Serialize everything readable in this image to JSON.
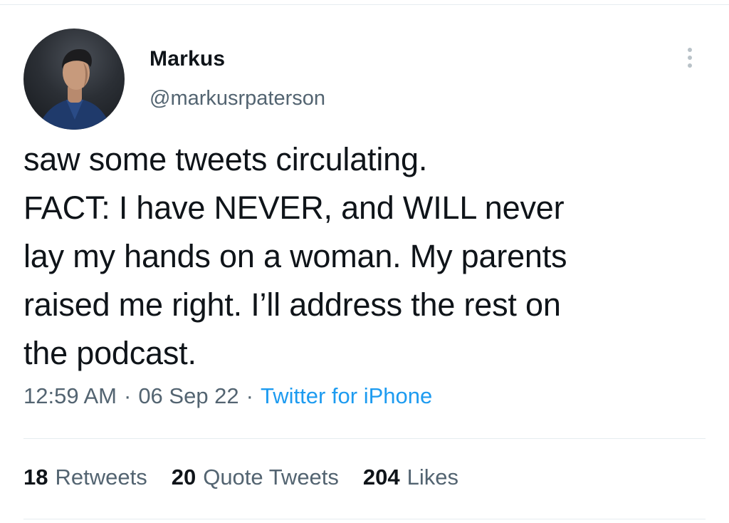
{
  "author": {
    "name": "Markus",
    "handle": "@markusrpaterson"
  },
  "tweet": {
    "text": "saw some tweets circulating.\nFACT: I have NEVER, and WILL never\nlay my hands on a woman. My parents\nraised me right. I’ll address the rest on\nthe podcast.",
    "time": "12:59 AM",
    "date": "06 Sep 22",
    "source": "Twitter for iPhone",
    "separator": "·"
  },
  "stats": {
    "retweets_count": "18",
    "retweets_label": "Retweets",
    "quotes_count": "20",
    "quotes_label": "Quote Tweets",
    "likes_count": "204",
    "likes_label": "Likes"
  },
  "icons": {
    "more": "more-vertical-icon"
  },
  "colors": {
    "text": "#0f1419",
    "secondary": "#536471",
    "link": "#1d9bf0",
    "divider": "#e6ecf0"
  }
}
